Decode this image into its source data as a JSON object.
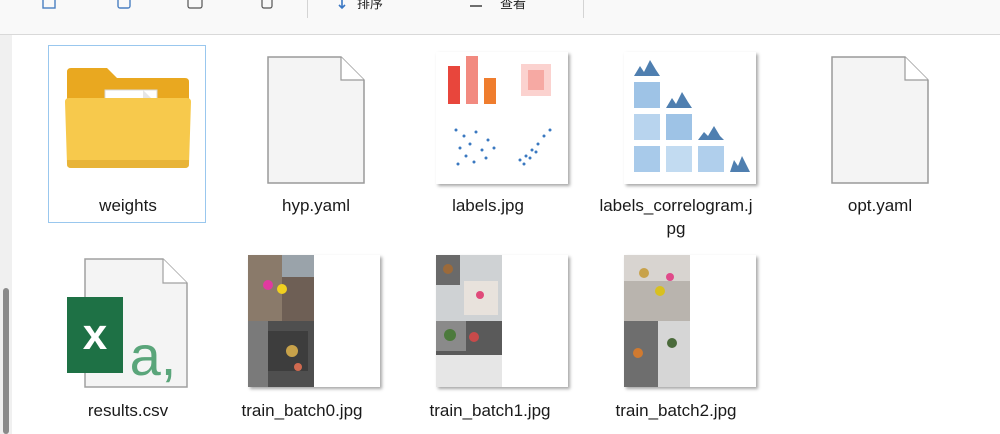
{
  "toolbar": {
    "sort_label": "排序",
    "view_label": "查看"
  },
  "files": [
    {
      "name": "weights",
      "kind": "folder-icon"
    },
    {
      "name": "hyp.yaml",
      "kind": "blank-file-icon"
    },
    {
      "name": "labels.jpg",
      "kind": "image-thumbnail"
    },
    {
      "name": "labels_correlogram.jpg",
      "kind": "image-thumbnail"
    },
    {
      "name": "opt.yaml",
      "kind": "blank-file-icon"
    },
    {
      "name": "results.csv",
      "kind": "excel-csv-icon"
    },
    {
      "name": "train_batch0.jpg",
      "kind": "image-thumbnail"
    },
    {
      "name": "train_batch1.jpg",
      "kind": "image-thumbnail"
    },
    {
      "name": "train_batch2.jpg",
      "kind": "image-thumbnail"
    }
  ],
  "colors": {
    "selection_border": "#99c7ee",
    "folder": "#f5c244",
    "excel_green": "#1e7145"
  }
}
